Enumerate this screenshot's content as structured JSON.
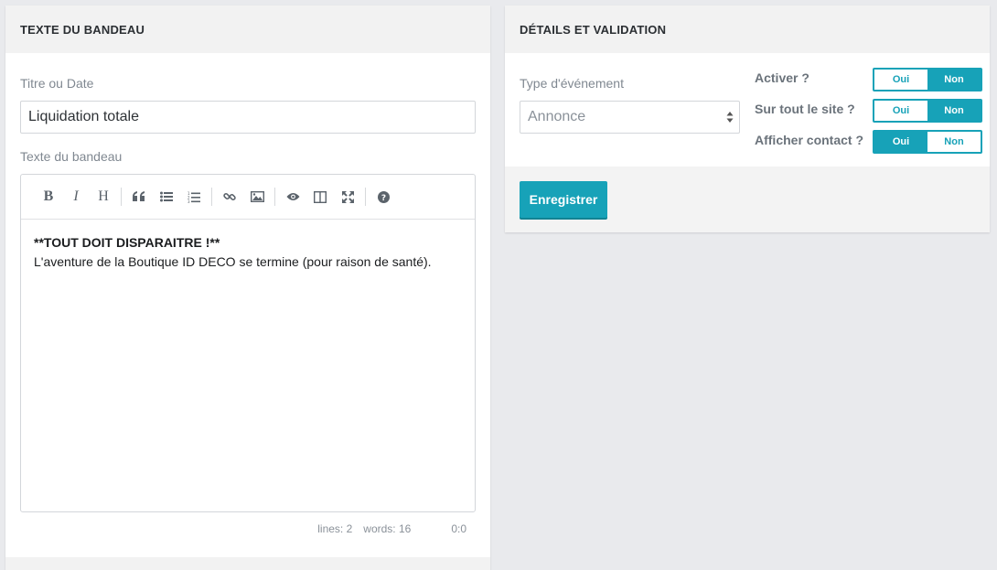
{
  "banner_panel": {
    "title": "TEXTE DU BANDEAU",
    "title_label": "Titre ou Date",
    "title_value": "Liquidation totale",
    "text_label": "Texte du bandeau",
    "editor": {
      "toolbar": [
        "bold-icon",
        "italic-icon",
        "heading-icon",
        "quote-icon",
        "unordered-list-icon",
        "ordered-list-icon",
        "link-icon",
        "image-icon",
        "preview-icon",
        "side-by-side-icon",
        "fullscreen-icon",
        "help-icon"
      ],
      "line1": "**TOUT DOIT DISPARAITRE !**",
      "line2": "L'aventure de la Boutique ID DECO se termine (pour raison de santé).",
      "status_lines": "lines: 2",
      "status_words": "words: 16",
      "status_cursor": "0:0"
    }
  },
  "details_panel": {
    "title": "DÉTAILS ET VALIDATION",
    "event_type_label": "Type d'événement",
    "event_type_value": "Annonce",
    "toggles": [
      {
        "label": "Activer ?",
        "on": "Oui",
        "off": "Non",
        "selected": "Non"
      },
      {
        "label": "Sur tout le site ?",
        "on": "Oui",
        "off": "Non",
        "selected": "Non"
      },
      {
        "label": "Afficher contact ?",
        "on": "Oui",
        "off": "Non",
        "selected": "Oui"
      }
    ],
    "save_label": "Enregistrer",
    "accent_color": "#17a2b8"
  }
}
